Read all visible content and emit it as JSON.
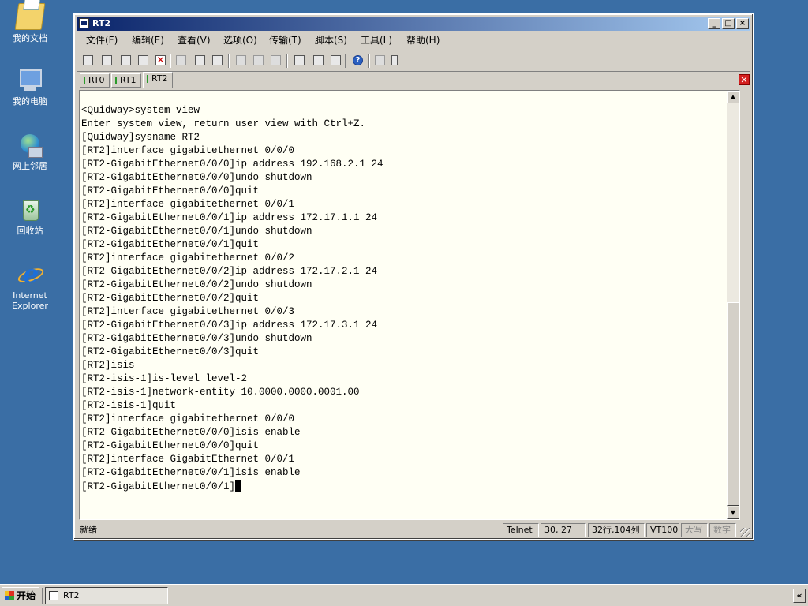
{
  "desktop": {
    "icons": [
      {
        "label": "我的文档",
        "icon": "my-documents-icon"
      },
      {
        "label": "我的电脑",
        "icon": "my-computer-icon"
      },
      {
        "label": "网上邻居",
        "icon": "network-places-icon"
      },
      {
        "label": "回收站",
        "icon": "recycle-bin-icon"
      },
      {
        "label": "Internet Explorer",
        "icon": "internet-explorer-icon"
      }
    ]
  },
  "window": {
    "title": "RT2",
    "controls": {
      "minimize": "_",
      "maximize": "□",
      "close": "×"
    },
    "menu": [
      "文件(F)",
      "编辑(E)",
      "查看(V)",
      "选项(O)",
      "传输(T)",
      "脚本(S)",
      "工具(L)",
      "帮助(H)"
    ],
    "tabs": [
      "RT0",
      "RT1",
      "RT2"
    ],
    "active_tab": "RT2",
    "terminal_lines": [
      "<Quidway>system-view",
      "Enter system view, return user view with Ctrl+Z.",
      "[Quidway]sysname RT2",
      "[RT2]interface gigabitethernet 0/0/0",
      "[RT2-GigabitEthernet0/0/0]ip address 192.168.2.1 24",
      "[RT2-GigabitEthernet0/0/0]undo shutdown",
      "[RT2-GigabitEthernet0/0/0]quit",
      "[RT2]interface gigabitethernet 0/0/1",
      "[RT2-GigabitEthernet0/0/1]ip address 172.17.1.1 24",
      "[RT2-GigabitEthernet0/0/1]undo shutdown",
      "[RT2-GigabitEthernet0/0/1]quit",
      "[RT2]interface gigabitethernet 0/0/2",
      "[RT2-GigabitEthernet0/0/2]ip address 172.17.2.1 24",
      "[RT2-GigabitEthernet0/0/2]undo shutdown",
      "[RT2-GigabitEthernet0/0/2]quit",
      "[RT2]interface gigabitethernet 0/0/3",
      "[RT2-GigabitEthernet0/0/3]ip address 172.17.3.1 24",
      "[RT2-GigabitEthernet0/0/3]undo shutdown",
      "[RT2-GigabitEthernet0/0/3]quit",
      "[RT2]isis",
      "[RT2-isis-1]is-level level-2",
      "[RT2-isis-1]network-entity 10.0000.0000.0001.00",
      "[RT2-isis-1]quit",
      "[RT2]interface gigabitethernet 0/0/0",
      "[RT2-GigabitEthernet0/0/0]isis enable",
      "[RT2-GigabitEthernet0/0/0]quit",
      "[RT2]interface GigabitEthernet 0/0/1",
      "[RT2-GigabitEthernet0/0/1]isis enable",
      "[RT2-GigabitEthernet0/0/1]"
    ],
    "status": {
      "ready": "就绪",
      "protocol": "Telnet",
      "cursor_pos": "30,  27",
      "size": "32行,104列",
      "emulation": "VT100",
      "caps": "大写",
      "num": "数字"
    }
  },
  "taskbar": {
    "start_label": "开始",
    "task_label": "RT2",
    "tray_chevron": "«"
  }
}
